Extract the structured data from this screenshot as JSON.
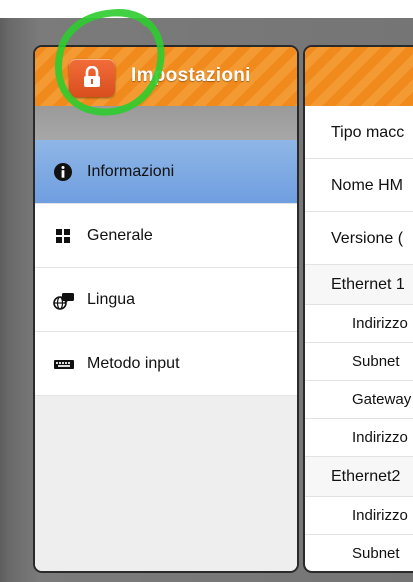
{
  "header": {
    "title": "Impostazioni",
    "lock_icon": "lock-icon",
    "accent_color": "#f08a1c"
  },
  "sidebar": {
    "items": [
      {
        "label": "Informazioni",
        "icon": "info-icon",
        "selected": true
      },
      {
        "label": "Generale",
        "icon": "grid-icon",
        "selected": false
      },
      {
        "label": "Lingua",
        "icon": "globe-chat-icon",
        "selected": false
      },
      {
        "label": "Metodo input",
        "icon": "keyboard-icon",
        "selected": false
      }
    ]
  },
  "detail": {
    "rows": [
      {
        "label": "Tipo macc",
        "kind": "main"
      },
      {
        "label": "Nome HM",
        "kind": "main"
      },
      {
        "label": "Versione (",
        "kind": "main"
      },
      {
        "label": "Ethernet 1",
        "kind": "sect"
      },
      {
        "label": "Indirizzo",
        "kind": "sub"
      },
      {
        "label": "Subnet",
        "kind": "sub"
      },
      {
        "label": "Gateway",
        "kind": "sub"
      },
      {
        "label": "Indirizzo",
        "kind": "sub"
      },
      {
        "label": "Ethernet2",
        "kind": "sect"
      },
      {
        "label": "Indirizzo",
        "kind": "sub"
      },
      {
        "label": "Subnet",
        "kind": "sub"
      }
    ]
  },
  "annotation": {
    "color": "#2ecc2e"
  }
}
